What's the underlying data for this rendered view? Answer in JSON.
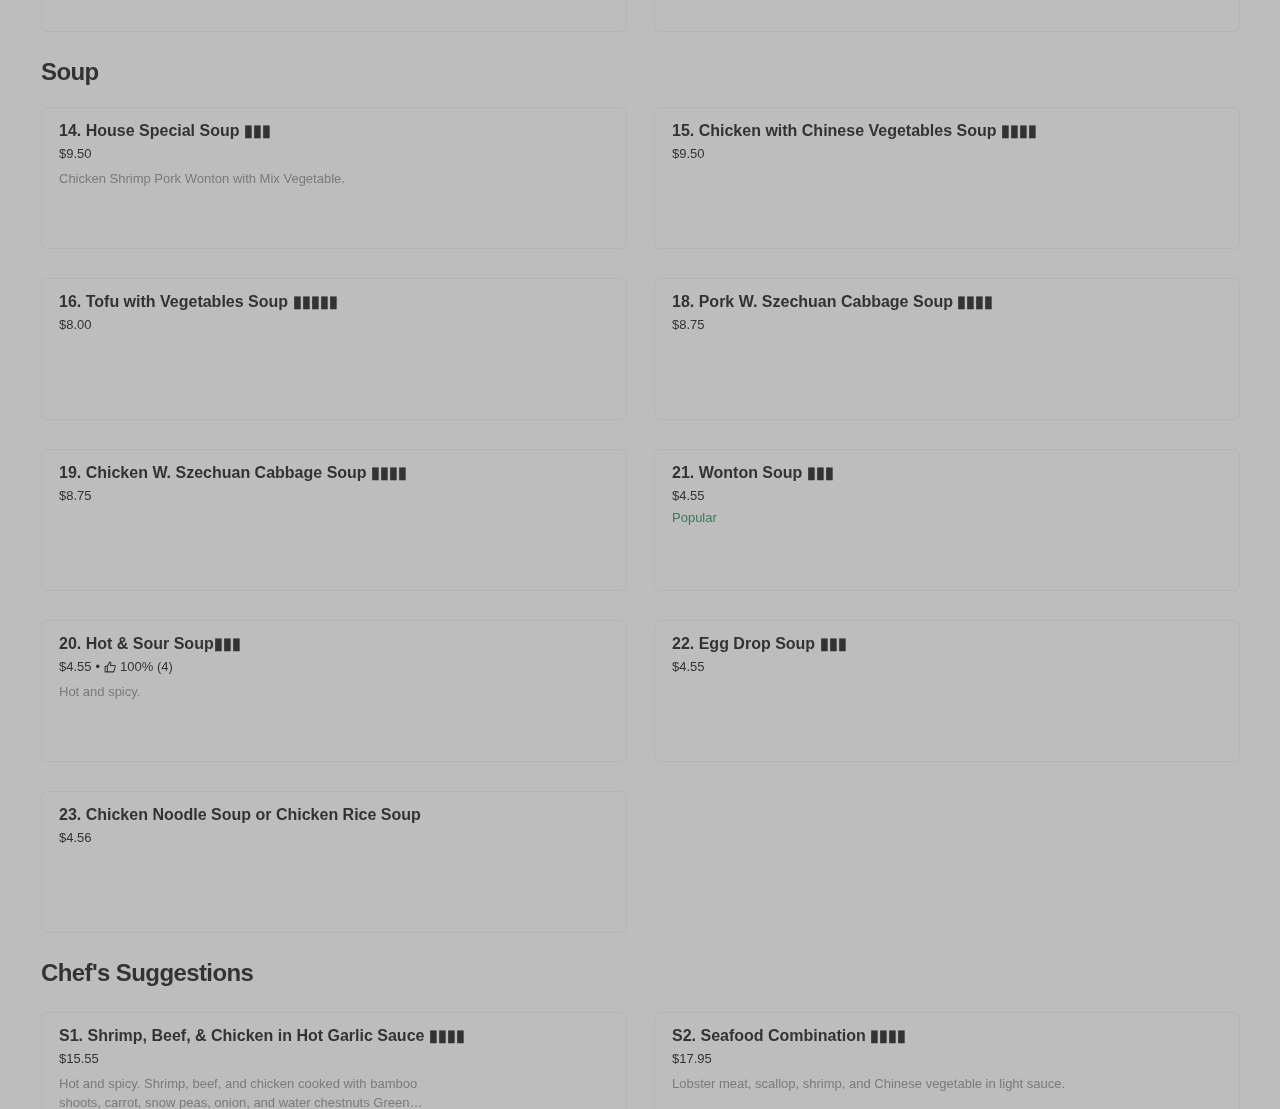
{
  "sections": [
    {
      "title": "Soup",
      "items": [
        {
          "title": "14. House Special Soup ▮▮▮",
          "price": "$9.50",
          "description": "Chicken Shrimp Pork Wonton with Mix Vegetable."
        },
        {
          "title": "15. Chicken with Chinese Vegetables Soup ▮▮▮▮",
          "price": "$9.50"
        },
        {
          "title": "16. Tofu with Vegetables Soup ▮▮▮▮▮",
          "price": "$8.00"
        },
        {
          "title": "18. Pork W. Szechuan Cabbage Soup ▮▮▮▮",
          "price": "$8.75"
        },
        {
          "title": "19. Chicken W. Szechuan Cabbage Soup ▮▮▮▮",
          "price": "$8.75"
        },
        {
          "title": "21. Wonton Soup ▮▮▮",
          "price": "$4.55",
          "badge": "Popular"
        },
        {
          "title": "20. Hot & Sour Soup▮▮▮",
          "price": "$4.55",
          "separator": "•",
          "rating": "100% (4)",
          "description": "Hot and spicy."
        },
        {
          "title": "22. Egg Drop Soup ▮▮▮",
          "price": "$4.55"
        },
        {
          "title": "23. Chicken Noodle Soup or Chicken Rice Soup",
          "price": "$4.56"
        }
      ]
    },
    {
      "title": "Chef's Suggestions",
      "items": [
        {
          "title": "S1. Shrimp, Beef, & Chicken in Hot Garlic Sauce ▮▮▮▮",
          "price": "$15.55",
          "description": "Hot and spicy. Shrimp, beef, and chicken cooked with bamboo shoots, carrot, snow peas, onion, and water chestnuts Green…"
        },
        {
          "title": "S2. Seafood Combination ▮▮▮▮",
          "price": "$17.95",
          "description": "Lobster meat, scallop, shrimp, and Chinese vegetable in light sauce."
        }
      ]
    }
  ]
}
